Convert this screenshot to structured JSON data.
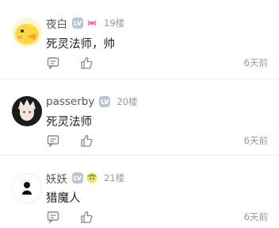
{
  "comments": [
    {
      "username": "夜白",
      "level_badge": "LV",
      "floor": "19楼",
      "text": "死灵法师，帅",
      "time": "6天前",
      "avatar_icon": "yellow-chick-avatar-icon",
      "extra_badge_icon": "pink-bow-badge-icon"
    },
    {
      "username": "passerby",
      "level_badge": "LV",
      "floor": "20楼",
      "text": "死灵法师",
      "time": "6天前",
      "avatar_icon": "white-haired-character-avatar-icon"
    },
    {
      "username": "妖妖",
      "level_badge": "LV",
      "floor": "21楼",
      "text": "猎魔人",
      "time": "6天前",
      "avatar_icon": "dark-figure-avatar-icon",
      "extra_badge_icon": "cartoon-face-badge-icon"
    }
  ],
  "colors": {
    "username": "#555555",
    "meta": "#999999",
    "level_badge_bg": "#b9c6d8",
    "divider": "#f4f4f4"
  }
}
